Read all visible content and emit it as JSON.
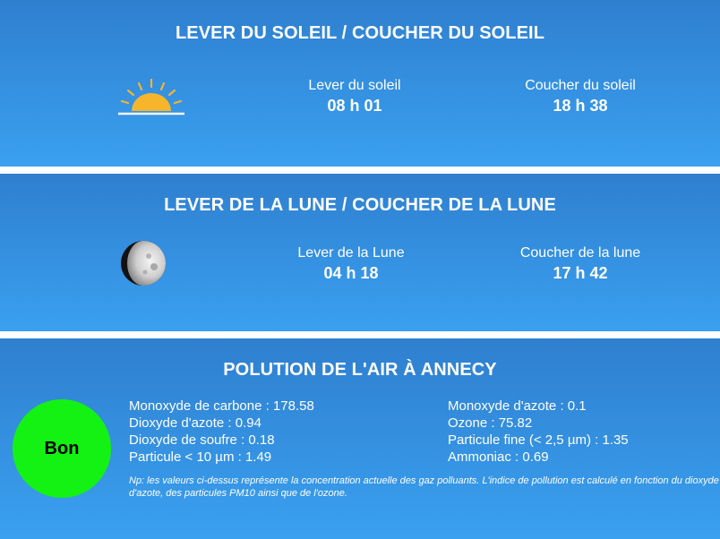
{
  "sun": {
    "title": "LEVER DU SOLEIL / COUCHER DU SOLEIL",
    "sunrise_label": "Lever du soleil",
    "sunrise_time": "08 h 01",
    "sunset_label": "Coucher du soleil",
    "sunset_time": "18 h 38",
    "icon": "sunrise-icon",
    "icon_color": "#f7b52c"
  },
  "moon": {
    "title": "LEVER DE LA LUNE / COUCHER DE LA LUNE",
    "moonrise_label": "Lever de la Lune",
    "moonrise_time": "04 h 18",
    "moonset_label": "Coucher de la lune",
    "moonset_time": "17 h 42",
    "icon": "moon-phase-icon"
  },
  "air": {
    "title": "POLUTION DE L'AIR À ANNECY",
    "quality_label": "Bon",
    "quality_color": "#14f214",
    "pollutants_left": [
      "Monoxyde de carbone : 178.58",
      "Dioxyde d'azote : 0.94",
      "Dioxyde de soufre : 0.18",
      "Particule < 10 µm : 1.49"
    ],
    "pollutants_right": [
      "Monoxyde d'azote : 0.1",
      "Ozone : 75.82",
      "Particule fine (< 2,5 µm) : 1.35",
      "Ammoniac : 0.69"
    ],
    "note": "Np: les valeurs ci-dessus représente la concentration actuelle des gaz polluants. L'indice de pollution est calculé en fonction du dioxyde d'azote, des particules PM10 ainsi que de l'ozone."
  },
  "colors": {
    "panel_top": "#2f7fcf",
    "panel_bottom": "#3aa0f0"
  }
}
